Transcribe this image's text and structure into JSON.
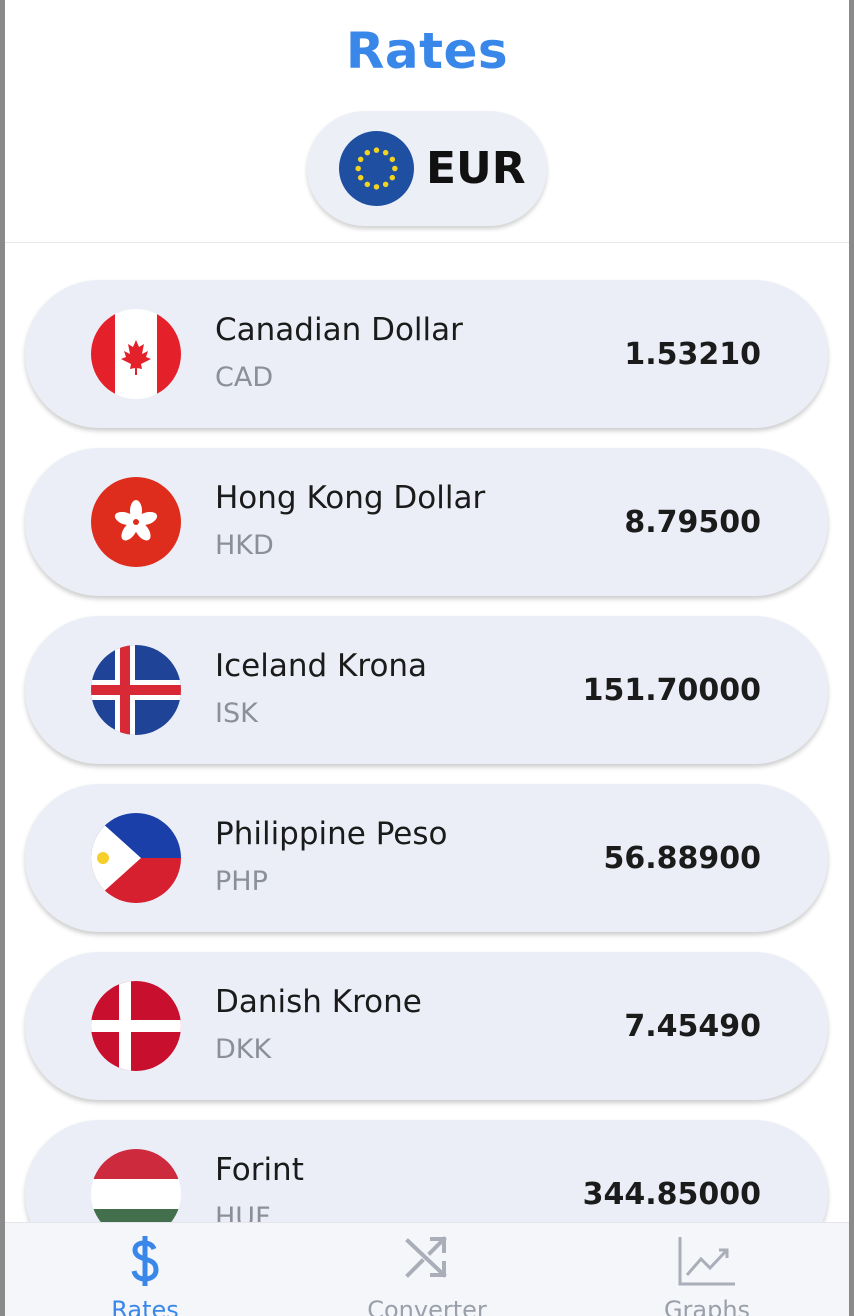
{
  "header": {
    "title": "Rates"
  },
  "base_currency": {
    "code": "EUR",
    "flag_icon": "eu-flag-icon"
  },
  "rates": [
    {
      "name": "Canadian Dollar",
      "code": "CAD",
      "rate": "1.53210",
      "flag_icon": "canada-flag-icon"
    },
    {
      "name": "Hong Kong Dollar",
      "code": "HKD",
      "rate": "8.79500",
      "flag_icon": "hong-kong-flag-icon"
    },
    {
      "name": "Iceland Krona",
      "code": "ISK",
      "rate": "151.70000",
      "flag_icon": "iceland-flag-icon"
    },
    {
      "name": "Philippine Peso",
      "code": "PHP",
      "rate": "56.88900",
      "flag_icon": "philippines-flag-icon"
    },
    {
      "name": "Danish Krone",
      "code": "DKK",
      "rate": "7.45490",
      "flag_icon": "denmark-flag-icon"
    },
    {
      "name": "Forint",
      "code": "HUF",
      "rate": "344.85000",
      "flag_icon": "hungary-flag-icon"
    }
  ],
  "nav": {
    "items": [
      {
        "label": "Rates",
        "icon": "dollar-icon",
        "active": true
      },
      {
        "label": "Converter",
        "icon": "shuffle-icon",
        "active": false
      },
      {
        "label": "Graphs",
        "icon": "chart-icon",
        "active": false
      }
    ]
  },
  "colors": {
    "accent": "#3a87ea",
    "card_bg": "#ebeef7",
    "inactive": "#9aa0aa"
  }
}
